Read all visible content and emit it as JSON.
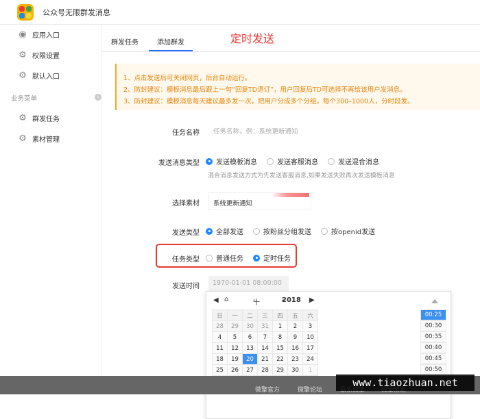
{
  "app": {
    "title": "公众号无限群发消息"
  },
  "sidebar": {
    "items": [
      {
        "label": "应用入口",
        "icon": "chat-bubble-icon"
      },
      {
        "label": "权限设置",
        "icon": "gear-icon"
      },
      {
        "label": "默认入口",
        "icon": "gear-icon"
      }
    ],
    "section_label": "业务菜单",
    "business_items": [
      {
        "label": "群发任务",
        "icon": "gear-icon"
      },
      {
        "label": "素材管理",
        "icon": "gear-icon"
      }
    ]
  },
  "tabs": [
    {
      "label": "群发任务",
      "active": false
    },
    {
      "label": "添加群发",
      "active": true
    }
  ],
  "annotation_title": "定时发送",
  "notice": [
    "1、点击发送后可关闭网页，后台自动运行。",
    "2、防封建议：模板消息最后跟上一句“回复TD退订”，用户回复后TD可选择不再给该用户发消息。",
    "3、防封建议：模板消息每天建议最多发一次，把用户分成多个分组，每个300–1000人，分时段发。"
  ],
  "form": {
    "task_name_label": "任务名称",
    "task_name_placeholder": "任务名称，例：系统更新通知",
    "msg_type_label": "发送消息类型",
    "msg_type_options": [
      "发送模板消息",
      "发送客服消息",
      "发送混合消息"
    ],
    "msg_type_selected": 0,
    "msg_type_hint": "混合消息发送方式为先发送客服消息,如果发送失败再次发送模板消息",
    "material_label": "选择素材",
    "material_value": "系统更新通知",
    "send_type_label": "发送类型",
    "send_type_options": [
      "全部发送",
      "按粉丝分组发送",
      "按openid发送"
    ],
    "send_type_selected": 0,
    "task_type_label": "任务类型",
    "task_type_options": [
      "普通任务",
      "定时任务"
    ],
    "task_type_selected": 1,
    "send_time_label": "发送时间",
    "send_time_placeholder": "1970-01-01 08:00:00"
  },
  "calendar": {
    "month_label": "十一月",
    "year_label": "2018",
    "weekdays": [
      "日",
      "一",
      "二",
      "三",
      "四",
      "五",
      "六"
    ],
    "rows": [
      [
        "28",
        "29",
        "30",
        "31",
        "1",
        "2",
        "3"
      ],
      [
        "4",
        "5",
        "6",
        "7",
        "8",
        "9",
        "10"
      ],
      [
        "11",
        "12",
        "13",
        "14",
        "15",
        "16",
        "17"
      ],
      [
        "18",
        "19",
        "20",
        "21",
        "22",
        "23",
        "24"
      ],
      [
        "25",
        "26",
        "27",
        "28",
        "29",
        "30",
        "1"
      ]
    ],
    "today": "20",
    "times": [
      "00:25",
      "00:30",
      "00:35",
      "00:40",
      "00:45",
      "00:50"
    ],
    "selected_time": "00:25"
  },
  "footer": {
    "items": [
      "微擎官方",
      "微擎论坛",
      "联系微擎",
      "微擎帮助"
    ]
  },
  "watermark": "www.tiaozhuan.net",
  "colors": {
    "accent": "#1e88ff",
    "notice_text": "#e8850c",
    "highlight_border": "#e53935"
  }
}
